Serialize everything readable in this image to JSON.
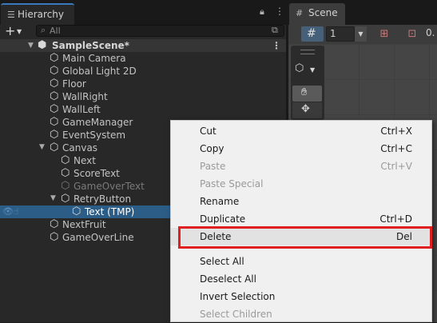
{
  "hierarchy": {
    "tab_label": "Hierarchy",
    "tab_icon": "list-icon",
    "search_placeholder": "All",
    "add_label": "+",
    "scene_name": "SampleScene*",
    "items": [
      {
        "label": "Main Camera",
        "depth": 1
      },
      {
        "label": "Global Light 2D",
        "depth": 1
      },
      {
        "label": "Floor",
        "depth": 1
      },
      {
        "label": "WallRight",
        "depth": 1
      },
      {
        "label": "WallLeft",
        "depth": 1
      },
      {
        "label": "GameManager",
        "depth": 1
      },
      {
        "label": "EventSystem",
        "depth": 1
      },
      {
        "label": "Canvas",
        "depth": 1,
        "expanded": true
      },
      {
        "label": "Next",
        "depth": 2
      },
      {
        "label": "ScoreText",
        "depth": 2
      },
      {
        "label": "GameOverText",
        "depth": 2,
        "inactive": true
      },
      {
        "label": "RetryButton",
        "depth": 2,
        "expanded": true
      },
      {
        "label": "Text (TMP)",
        "depth": 3,
        "selected": true
      },
      {
        "label": "NextFruit",
        "depth": 1
      },
      {
        "label": "GameOverLine",
        "depth": 1
      }
    ]
  },
  "scene": {
    "tab_label": "Scene",
    "tab_icon": "grid-icon",
    "grid_size": "1",
    "snap_value": "0."
  },
  "context_menu": {
    "items": [
      {
        "label": "Cut",
        "shortcut": "Ctrl+X",
        "enabled": true
      },
      {
        "label": "Copy",
        "shortcut": "Ctrl+C",
        "enabled": true
      },
      {
        "label": "Paste",
        "shortcut": "Ctrl+V",
        "enabled": false
      },
      {
        "label": "Paste Special",
        "shortcut": "",
        "enabled": false
      },
      {
        "label": "Rename",
        "shortcut": "",
        "enabled": true
      },
      {
        "label": "Duplicate",
        "shortcut": "Ctrl+D",
        "enabled": true
      },
      {
        "label": "Delete",
        "shortcut": "Del",
        "enabled": true,
        "highlighted": true
      },
      {
        "label": "Select All",
        "shortcut": "",
        "enabled": true
      },
      {
        "label": "Deselect All",
        "shortcut": "",
        "enabled": true
      },
      {
        "label": "Invert Selection",
        "shortcut": "",
        "enabled": true
      },
      {
        "label": "Select Children",
        "shortcut": "",
        "enabled": false
      }
    ]
  },
  "colors": {
    "selection": "#2c5d87",
    "highlight_box": "#e02020",
    "accent": "#3a79bb"
  }
}
